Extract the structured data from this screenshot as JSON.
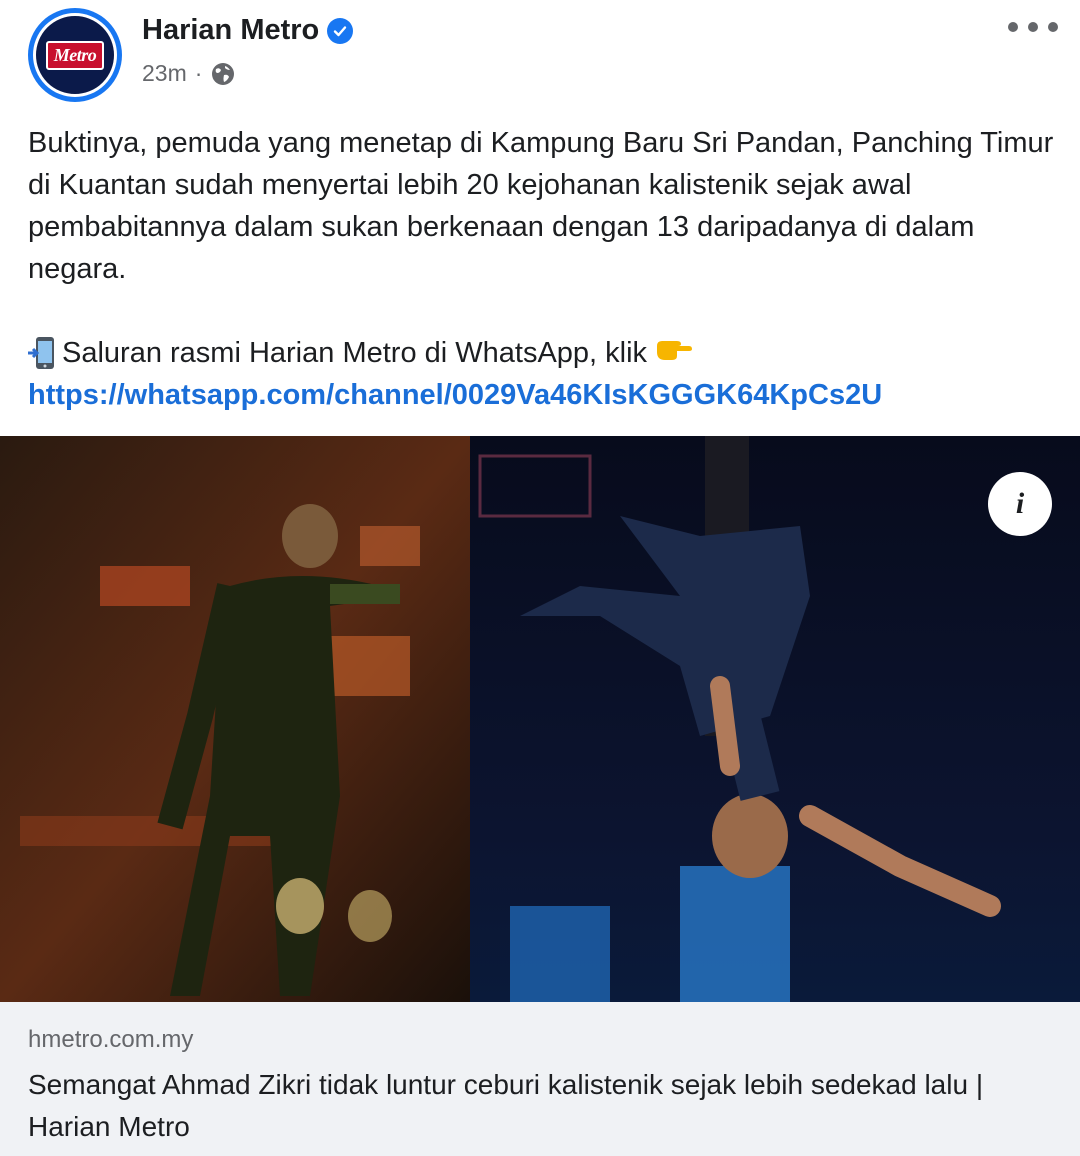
{
  "header": {
    "page_name": "Harian Metro",
    "logo_text": "Metro",
    "timestamp": "23m",
    "separator": "·",
    "verified": true,
    "privacy_icon": "globe-icon",
    "more_icon": "more-horizontal-icon"
  },
  "post": {
    "body": "Buktinya, pemuda yang menetap di Kampung Baru Sri Pandan, Panching Timur di Kuantan sudah menyertai lebih 20 kejohanan kalistenik sejak awal pembabitannya dalam sukan berkenaan dengan 13 daripadanya di dalam negara.",
    "whatsapp_text": "Saluran rasmi Harian Metro di WhatsApp, klik",
    "whatsapp_leading_icon": "mobile-phone-arrow-icon",
    "whatsapp_trailing_icon": "pointing-hand-icon",
    "link": "https://whatsapp.com/channel/0029Va46KIsKGGGK64KpCs2U"
  },
  "image": {
    "info_icon": "info-icon",
    "info_glyph": "i"
  },
  "preview": {
    "domain": "hmetro.com.my",
    "title": "Semangat Ahmad Zikri tidak luntur ceburi kalistenik sejak lebih sedekad lalu | Harian Metro"
  },
  "colors": {
    "link": "#1a6ed8",
    "verified": "#1877f2",
    "secondary_text": "#65676b",
    "preview_bg": "#f0f2f5",
    "logo_red": "#c8102e"
  }
}
